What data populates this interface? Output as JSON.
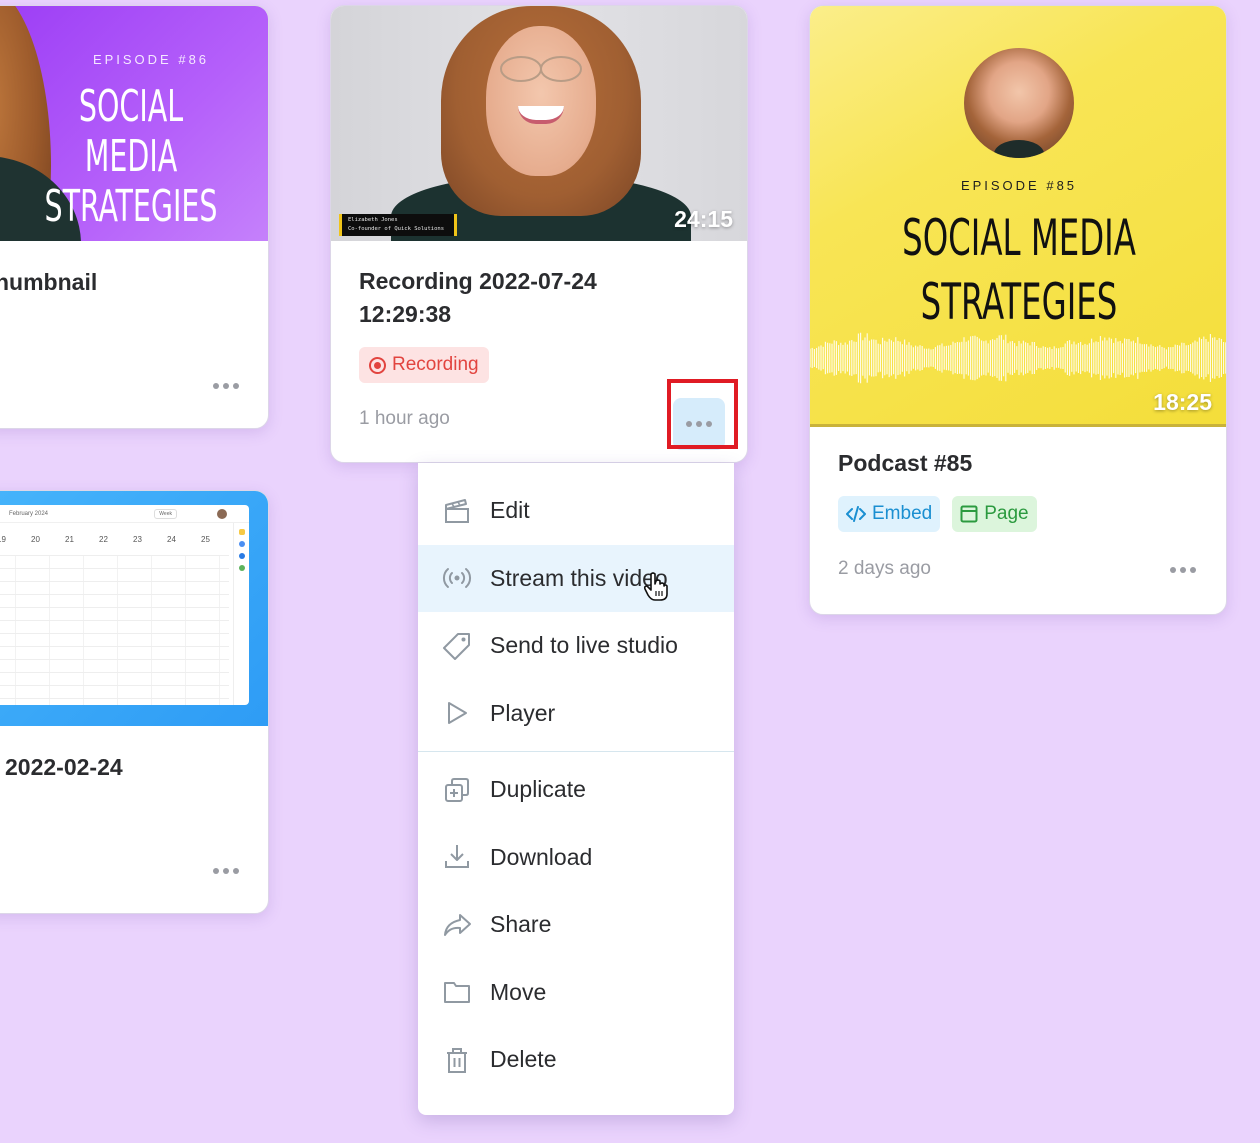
{
  "cards": [
    {
      "id": "episode-86",
      "thumbnail": {
        "episode_label": "EPISODE #86",
        "title_line1": "SOCIAL MEDIA",
        "title_line2": "STRATEGIES",
        "bg_color": "#a64cf7"
      },
      "title": "humbnail",
      "more_label": "more options"
    },
    {
      "id": "recording",
      "thumbnail": {
        "lower_third_name": "Elizabeth Jones",
        "lower_third_role": "Co-founder of Quick Solutions",
        "duration": "24:15"
      },
      "title_line1": "Recording 2022-07-24",
      "title_line2": "12:29:38",
      "status_badge": "Recording",
      "status_color": "#e2443f",
      "time_ago": "1 hour ago"
    },
    {
      "id": "podcast-85",
      "thumbnail": {
        "episode_label": "EPISODE #85",
        "title_line1": "SOCIAL MEDIA",
        "title_line2": "STRATEGIES",
        "duration": "18:25",
        "bg_color": "#f6e24a"
      },
      "title": "Podcast #85",
      "tags": [
        "Embed",
        "Page"
      ],
      "time_ago": "2 days ago"
    },
    {
      "id": "calendar-recording",
      "thumbnail": {
        "calendar_month": "February 2024",
        "view_label": "Week",
        "days": [
          "19",
          "20",
          "21",
          "22",
          "23",
          "24",
          "25"
        ]
      },
      "title": "2022-02-24"
    }
  ],
  "context_menu": {
    "group1": [
      {
        "label": "Edit",
        "icon": "clapperboard-icon"
      },
      {
        "label": "Stream this video",
        "icon": "broadcast-icon",
        "hovered": true
      },
      {
        "label": "Send to live studio",
        "icon": "tag-icon"
      },
      {
        "label": "Player",
        "icon": "play-icon"
      }
    ],
    "group2": [
      {
        "label": "Duplicate",
        "icon": "duplicate-icon"
      },
      {
        "label": "Download",
        "icon": "download-icon"
      },
      {
        "label": "Share",
        "icon": "share-icon"
      },
      {
        "label": "Move",
        "icon": "folder-icon"
      },
      {
        "label": "Delete",
        "icon": "trash-icon"
      }
    ]
  },
  "colors": {
    "background": "#ead3fd",
    "highlight": "#e01b24",
    "menu_hover": "#e8f4fd"
  }
}
